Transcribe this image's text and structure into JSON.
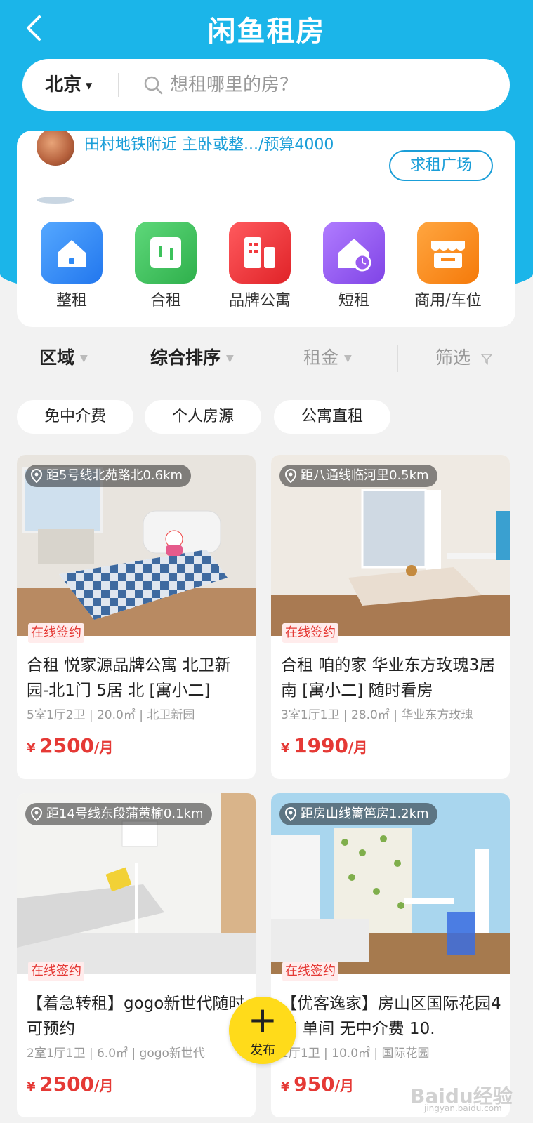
{
  "header": {
    "back_icon": "back-chevron-icon",
    "logo": "闲鱼租房",
    "city": "北京",
    "search_placeholder": "想租哪里的房？"
  },
  "request_banner": {
    "text": "田村地铁附近 主卧或整.../预算4000",
    "button": "求租广场"
  },
  "categories": [
    {
      "label": "整租",
      "icon": "house-icon",
      "color": "#2f8af6"
    },
    {
      "label": "合租",
      "icon": "shared-room-icon",
      "color": "#3cc25b"
    },
    {
      "label": "品牌公寓",
      "icon": "building-icon",
      "color": "#f23a3e"
    },
    {
      "label": "短租",
      "icon": "house-clock-icon",
      "color": "#9a5cf0"
    },
    {
      "label": "商用/车位",
      "icon": "shop-icon",
      "color": "#fb8a1c"
    }
  ],
  "filters": [
    {
      "label": "区域"
    },
    {
      "label": "综合排序"
    },
    {
      "label": "租金"
    },
    {
      "label": "筛选"
    }
  ],
  "tags": [
    "免中介费",
    "个人房源",
    "公寓直租"
  ],
  "listings": [
    {
      "distance": "距5号线北苑路北0.6km",
      "badge": "在线签约",
      "title": "合租 悦家源品牌公寓 北卫新园-北1门 5居 北 [寓小二]",
      "meta": "5室1厅2卫 | 20.0㎡ | 北卫新园",
      "currency": "¥",
      "price": "2500",
      "unit": "/月"
    },
    {
      "distance": "距八通线临河里0.5km",
      "badge": "在线签约",
      "title": "合租 咱的家 华业东方玫瑰3居 南 [寓小二] 随时看房",
      "meta": "3室1厅1卫 | 28.0㎡ | 华业东方玫瑰",
      "currency": "¥",
      "price": "1990",
      "unit": "/月"
    },
    {
      "distance": "距14号线东段蒲黄榆0.1km",
      "badge": "在线签约",
      "title": "【着急转租】gogo新世代随时可预约",
      "meta": "2室1厅1卫 | 6.0㎡ | gogo新世代",
      "currency": "¥",
      "price": "2500",
      "unit": "/月"
    },
    {
      "distance": "距房山线篱笆房1.2km",
      "badge": "在线签约",
      "title": "【优客逸家】房山区国际花园4室 单间 无中介费 10.",
      "meta": "1厅1卫 | 10.0㎡ | 国际花园",
      "currency": "¥",
      "price": "950",
      "unit": "/月"
    }
  ],
  "fab": {
    "label": "发布"
  },
  "watermark": {
    "text": "Baidu经验",
    "sub": "jingyan.baidu.com"
  }
}
